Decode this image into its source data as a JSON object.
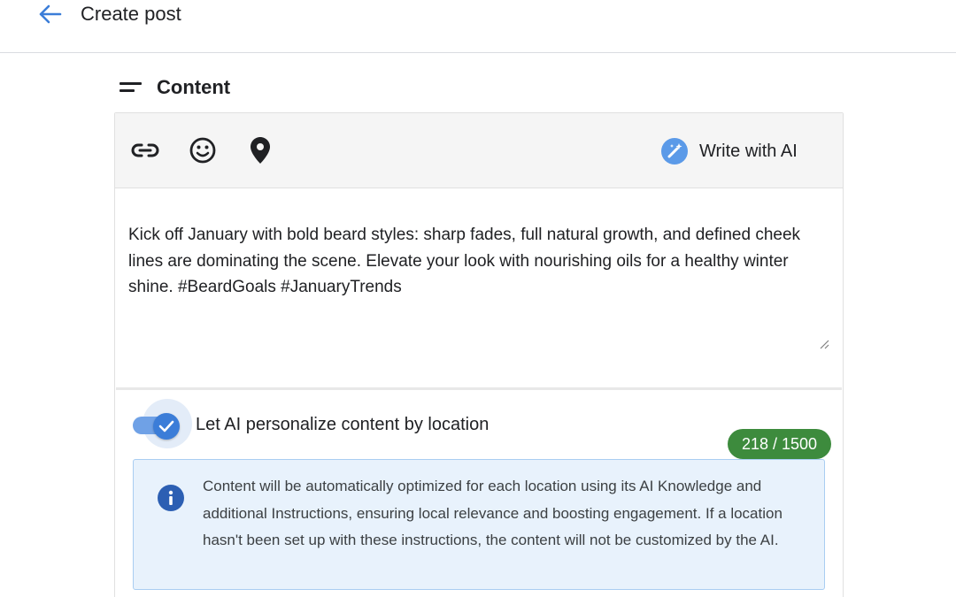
{
  "header": {
    "title": "Create post",
    "back_icon": "arrow-left-icon"
  },
  "section": {
    "title": "Content",
    "icon": "short-text-icon"
  },
  "toolbar": {
    "tools": [
      "link-icon",
      "emoji-icon",
      "location-pin-icon"
    ],
    "write_ai_label": "Write with AI",
    "write_ai_icon": "magic-wand-icon"
  },
  "editor": {
    "text": "Kick off January with bold beard styles: sharp fades, full natural growth, and defined cheek lines are dominating the scene. Elevate your look with nourishing oils for a healthy winter shine. #BeardGoals #JanuaryTrends",
    "counter": "218 / 1500"
  },
  "toggle": {
    "label": "Let AI personalize content by location",
    "checked": true
  },
  "info": {
    "text": "Content will be automatically optimized for each location using its AI Knowledge and additional Instructions, ensuring local relevance and boosting engagement. If a location hasn't been set up with these instructions, the content will not be customized by the AI."
  },
  "colors": {
    "accent": "#3b7dd8",
    "counter_bg": "#3d8b3d",
    "info_bg": "#e8f2fc",
    "info_border": "#a9cdf2",
    "toolbar_bg": "#f5f5f5"
  }
}
